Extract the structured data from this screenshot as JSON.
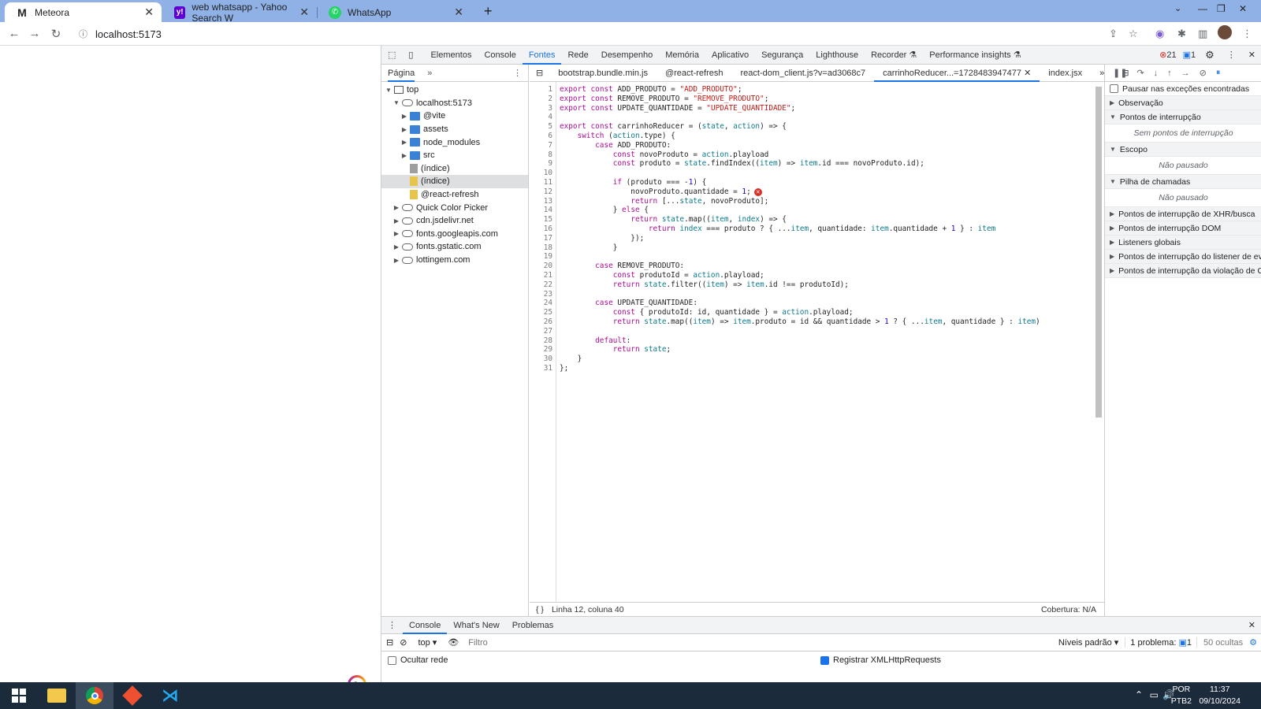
{
  "browser": {
    "tabs": [
      {
        "title": "Meteora",
        "icon": "gmail-icon",
        "active": true
      },
      {
        "title": "web whatsapp - Yahoo Search W",
        "icon": "yahoo-icon",
        "active": false
      },
      {
        "title": "WhatsApp",
        "icon": "whatsapp-icon",
        "active": false
      }
    ],
    "new_tab": "+",
    "url": "localhost:5173"
  },
  "devtools": {
    "tabs": [
      "Elementos",
      "Console",
      "Fontes",
      "Rede",
      "Desempenho",
      "Memória",
      "Aplicativo",
      "Segurança",
      "Lighthouse",
      "Recorder",
      "Performance insights"
    ],
    "active_tab": "Fontes",
    "error_count": "21",
    "message_count": "1",
    "navigator": {
      "tab": "Página",
      "tree": [
        {
          "label": "top",
          "depth": 0,
          "icon": "frame",
          "open": true
        },
        {
          "label": "localhost:5173",
          "depth": 1,
          "icon": "cloud",
          "open": true
        },
        {
          "label": "@vite",
          "depth": 2,
          "icon": "folder",
          "open": false
        },
        {
          "label": "assets",
          "depth": 2,
          "icon": "folder",
          "open": false
        },
        {
          "label": "node_modules",
          "depth": 2,
          "icon": "folder",
          "open": false
        },
        {
          "label": "src",
          "depth": 2,
          "icon": "folder",
          "open": false
        },
        {
          "label": "(índice)",
          "depth": 2,
          "icon": "file",
          "open": null
        },
        {
          "label": "(índice)",
          "depth": 2,
          "icon": "file-y",
          "open": null,
          "selected": true
        },
        {
          "label": "@react-refresh",
          "depth": 2,
          "icon": "file-y",
          "open": null
        },
        {
          "label": "Quick Color Picker",
          "depth": 1,
          "icon": "cloud",
          "open": false
        },
        {
          "label": "cdn.jsdelivr.net",
          "depth": 1,
          "icon": "cloud",
          "open": false
        },
        {
          "label": "fonts.googleapis.com",
          "depth": 1,
          "icon": "cloud",
          "open": false
        },
        {
          "label": "fonts.gstatic.com",
          "depth": 1,
          "icon": "cloud",
          "open": false
        },
        {
          "label": "lottingem.com",
          "depth": 1,
          "icon": "cloud",
          "open": false
        }
      ]
    },
    "editor_tabs": [
      "bootstrap.bundle.min.js",
      "@react-refresh",
      "react-dom_client.js?v=ad3068c7",
      "carrinhoReducer...=1728483947477",
      "index.jsx"
    ],
    "active_editor_tab": "carrinhoReducer...=1728483947477",
    "code_lines": [
      "export const ADD_PRODUTO = \"ADD_PRODUTO\";",
      "export const REMOVE_PRODUTO = \"REMOVE_PRODUTO\";",
      "export const UPDATE_QUANTIDADE = \"UPDATE_QUANTIDADE\";",
      "",
      "export const carrinhoReducer = (state, action) => {",
      "    switch (action.type) {",
      "        case ADD_PRODUTO:",
      "            const novoProduto = action.playload",
      "            const produto = state.findIndex((item) => item.id === novoProduto.id);",
      "",
      "            if (produto === -1) {",
      "                novoProduto.quantidade = 1;",
      "                return [...state, novoProduto];",
      "            } else {",
      "                return state.map((item, index) => {",
      "                    return index === produto ? { ...item, quantidade: item.quantidade + 1 } : item",
      "                });",
      "            }",
      "",
      "        case REMOVE_PRODUTO:",
      "            const produtoId = action.playload;",
      "            return state.filter((item) => item.id !== produtoId);",
      "",
      "        case UPDATE_QUANTIDADE:",
      "            const { produtoId: id, quantidade } = action.playload;",
      "            return state.map((item) => item.produto = id && quantidade > 1 ? { ...item, quantidade } : item)",
      "",
      "        default:",
      "            return state;",
      "    }",
      "};"
    ],
    "status_position": "Linha 12, coluna 40",
    "coverage": "Cobertura: N/A",
    "debugger": {
      "pause_exceptions": "Pausar nas exceções encontradas",
      "sections": [
        {
          "title": "Observação",
          "open": false
        },
        {
          "title": "Pontos de interrupção",
          "open": true,
          "empty": "Sem pontos de interrupção"
        },
        {
          "title": "Escopo",
          "open": true,
          "empty": "Não pausado"
        },
        {
          "title": "Pilha de chamadas",
          "open": true,
          "empty": "Não pausado"
        },
        {
          "title": "Pontos de interrupção de XHR/busca",
          "open": false
        },
        {
          "title": "Pontos de interrupção DOM",
          "open": false
        },
        {
          "title": "Listeners globais",
          "open": false
        },
        {
          "title": "Pontos de interrupção do listener de ev",
          "open": false
        },
        {
          "title": "Pontos de interrupção da violação de C",
          "open": false
        }
      ]
    },
    "drawer": {
      "tabs": [
        "Console",
        "What's New",
        "Problemas"
      ],
      "active": "Console",
      "context": "top ▾",
      "filter_placeholder": "Filtro",
      "levels": "Níveis padrão ▾",
      "problems": "1 problema:",
      "problems_count": "1",
      "hidden": "50 ocultas",
      "hide_network": "Ocultar rede",
      "log_xhr": "Registrar XMLHttpRequests"
    }
  },
  "taskbar": {
    "lang": "POR",
    "lang2": "PTB2",
    "time": "11:37",
    "date": "09/10/2024"
  }
}
